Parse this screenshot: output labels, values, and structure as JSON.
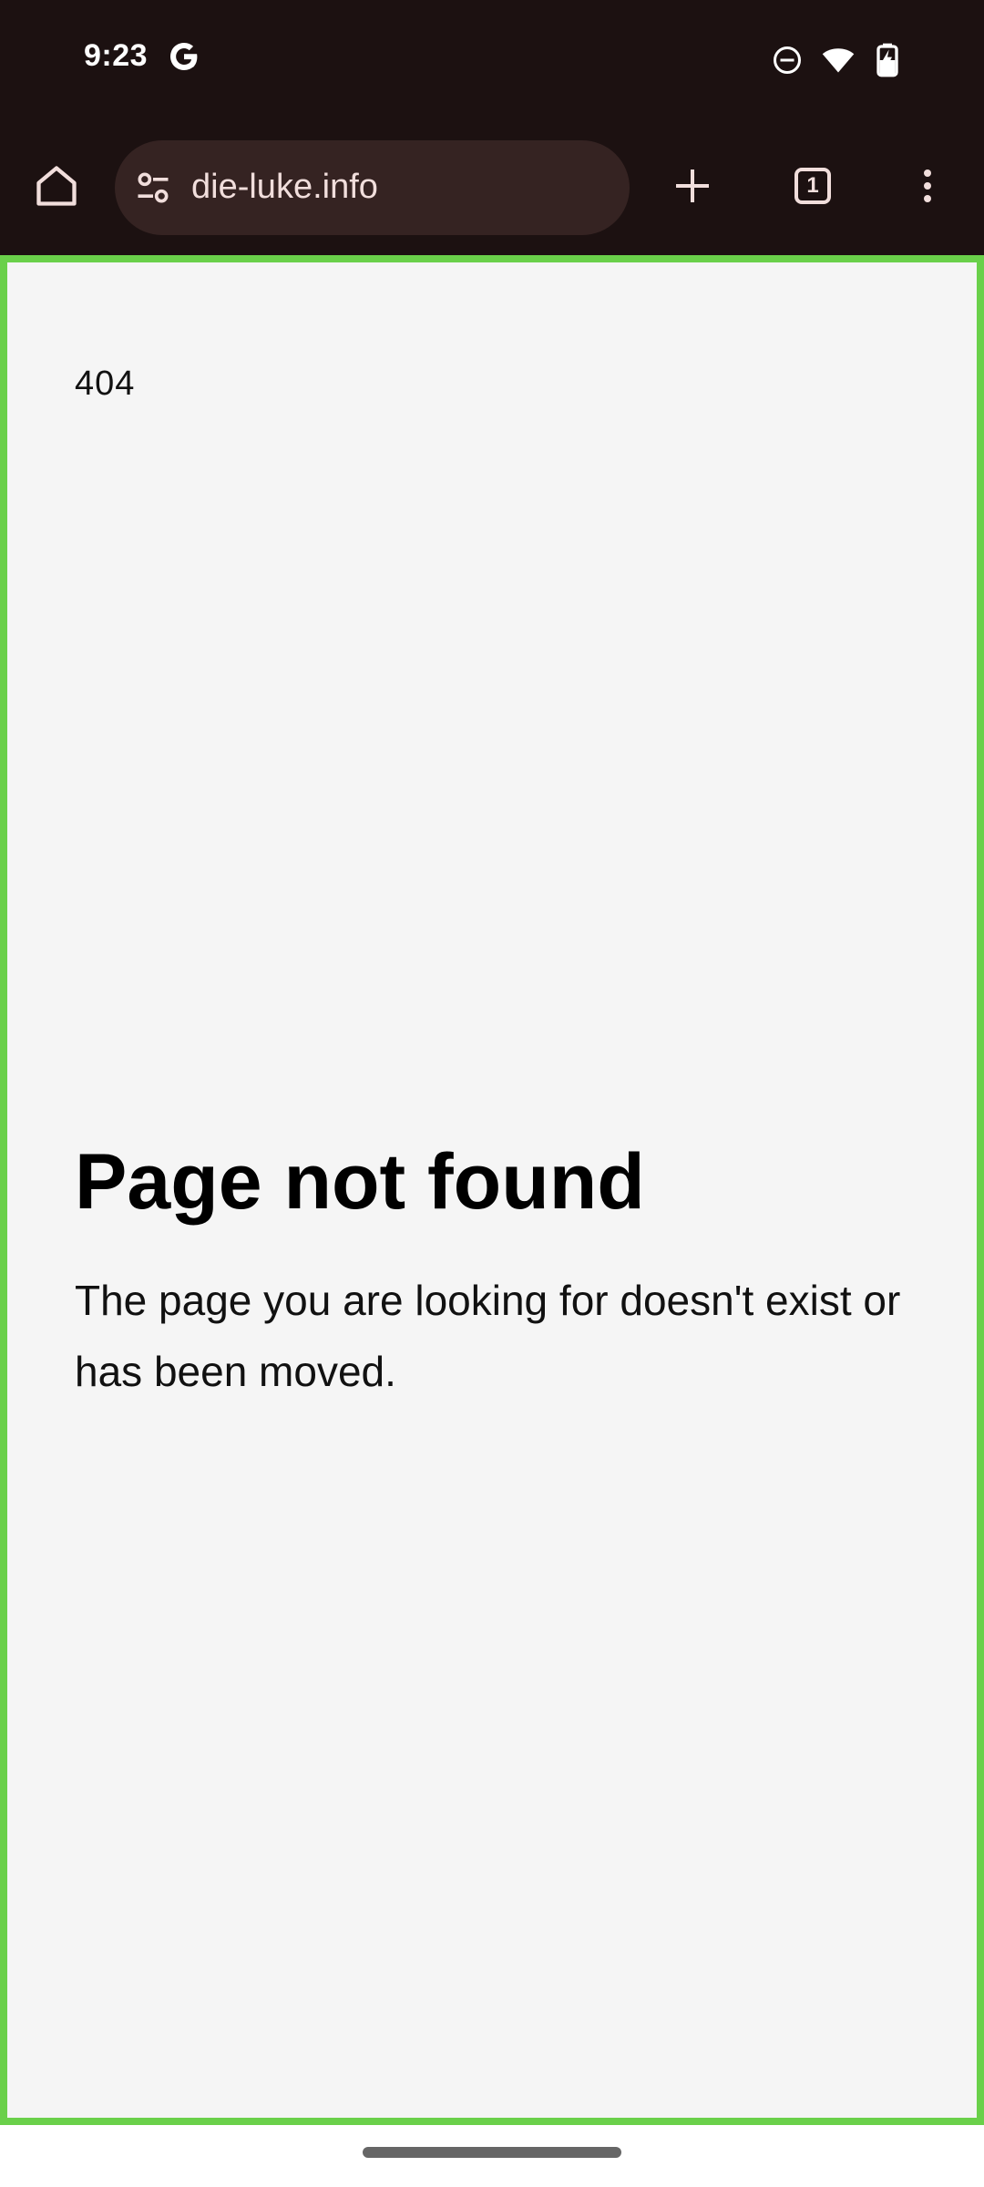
{
  "status_bar": {
    "time": "9:23",
    "google_icon": "google-g-icon",
    "icons": [
      "do-not-disturb-icon",
      "wifi-icon",
      "battery-charging-icon"
    ]
  },
  "browser": {
    "url": "die-luke.info",
    "tab_count": "1",
    "icons": {
      "home": "home-icon",
      "site_settings": "tune-icon",
      "new_tab": "plus-icon",
      "tabs": "tab-switcher-icon",
      "menu": "more-vert-icon"
    },
    "highlight_color": "#6ad04a"
  },
  "page": {
    "code": "404",
    "title": "Page not found",
    "description": "The page you are looking for doesn't exist or has been moved."
  }
}
